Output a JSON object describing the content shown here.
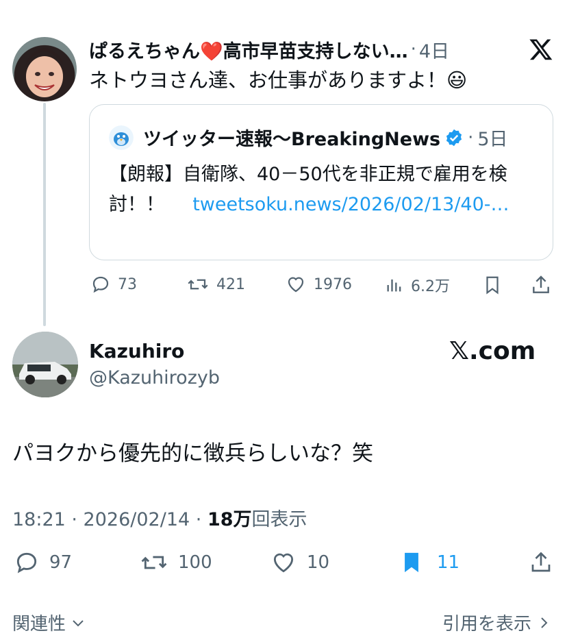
{
  "tweet1": {
    "author_name": "ぱるえちゃん❤️高市早苗支持しない…",
    "dot": "·",
    "time": "4日",
    "text": "ネトウヨさん達、お仕事がありますよ！😃",
    "quote": {
      "author_name": "ツイッター速報〜BreakingNews",
      "dot": "·",
      "time": "5日",
      "text": "【朗報】自衛隊、40－50代を非正規で雇用を検討！！",
      "link": "tweetsoku.news/2026/02/13/40-…"
    },
    "stats": {
      "replies": "73",
      "retweets": "421",
      "likes": "1976",
      "views": "6.2万"
    }
  },
  "tweet2": {
    "author_name": "Kazuhiro",
    "handle": "@Kazuhirozyb",
    "brand": "𝕏.com",
    "text": "パヨクから優先的に徴兵らしいな？笑",
    "meta": {
      "time": "18:21 · 2026/02/14 · ",
      "views": "18万",
      "views_label": "回表示"
    },
    "stats": {
      "replies": "97",
      "retweets": "100",
      "likes": "10",
      "bookmarks": "11"
    }
  },
  "footer": {
    "left": "関連性",
    "right": "引用を表示"
  },
  "colors": {
    "accent": "#1d9bf0",
    "muted": "#536471",
    "line": "#cfd9de"
  }
}
